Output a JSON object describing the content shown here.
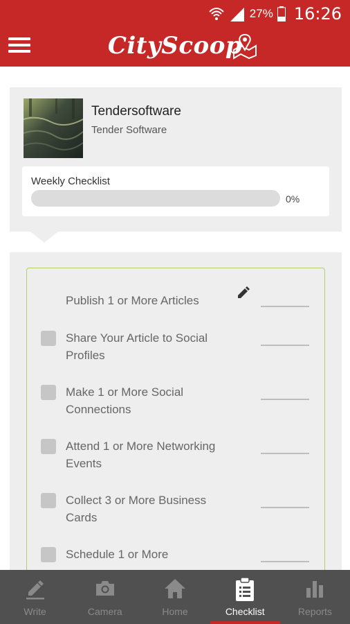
{
  "status_bar": {
    "battery": "27%",
    "time": "16:26"
  },
  "app_bar": {
    "brand": "CityScoop"
  },
  "profile": {
    "name": "Tendersoftware",
    "subtitle": "Tender Software",
    "weekly_label": "Weekly Checklist",
    "progress_text": "0%",
    "progress_fraction": 0
  },
  "checklist": {
    "items": [
      {
        "label": "Publish 1 or More Articles",
        "has_checkbox": false
      },
      {
        "label": "Share Your Article to Social Profiles",
        "has_checkbox": true
      },
      {
        "label": "Make 1 or More Social Connections",
        "has_checkbox": true
      },
      {
        "label": "Attend 1 or More Networking Events",
        "has_checkbox": true
      },
      {
        "label": "Collect 3 or More Business Cards",
        "has_checkbox": true
      },
      {
        "label": "Schedule 1 or More",
        "has_checkbox": true
      }
    ]
  },
  "bottom_nav": {
    "items": [
      {
        "label": "Write",
        "icon": "pencil-icon",
        "active": false
      },
      {
        "label": "Camera",
        "icon": "camera-icon",
        "active": false
      },
      {
        "label": "Home",
        "icon": "home-icon",
        "active": false
      },
      {
        "label": "Checklist",
        "icon": "clipboard-icon",
        "active": true
      },
      {
        "label": "Reports",
        "icon": "bar-chart-icon",
        "active": false
      }
    ]
  },
  "colors": {
    "primary": "#c62828",
    "nav_bg": "#505050",
    "accent_border": "#b5cc6e"
  }
}
